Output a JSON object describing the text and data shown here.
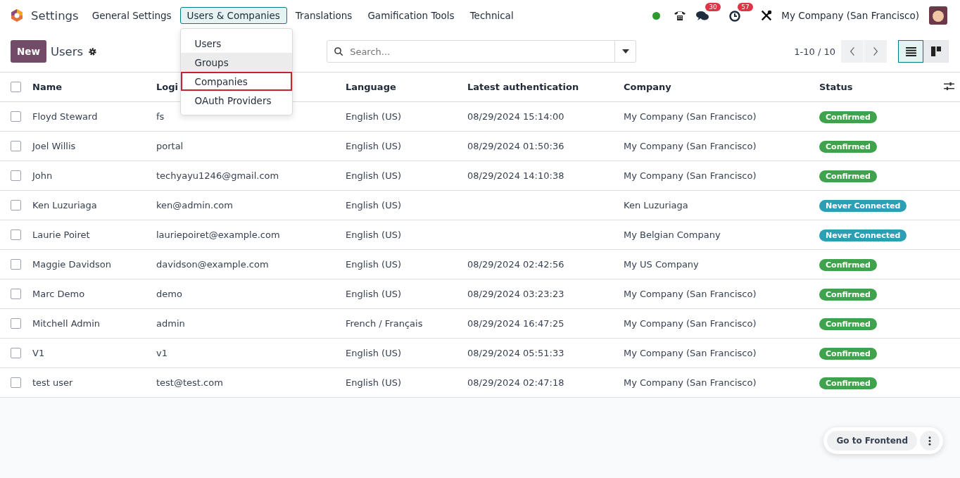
{
  "navbar": {
    "app_name": "Settings",
    "menus": [
      {
        "label": "General Settings",
        "selected": false
      },
      {
        "label": "Users & Companies",
        "selected": true
      },
      {
        "label": "Translations",
        "selected": false
      },
      {
        "label": "Gamification Tools",
        "selected": false
      },
      {
        "label": "Technical",
        "selected": false
      }
    ],
    "messages_badge": "30",
    "activities_badge": "57",
    "company": "My Company (San Francisco)"
  },
  "dropdown": {
    "items": [
      {
        "label": "Users",
        "hovered": false,
        "highlighted": false
      },
      {
        "label": "Groups",
        "hovered": true,
        "highlighted": false
      },
      {
        "label": "Companies",
        "hovered": false,
        "highlighted": true
      },
      {
        "label": "OAuth Providers",
        "hovered": false,
        "highlighted": false
      }
    ]
  },
  "control_panel": {
    "new_button": "New",
    "title": "Users",
    "search": {
      "placeholder": "Search..."
    },
    "pager": "1-10 / 10",
    "views": [
      {
        "kind": "list",
        "selected": true
      },
      {
        "kind": "kanban",
        "selected": false
      }
    ]
  },
  "table": {
    "all_checked": false,
    "columns": [
      "Name",
      "Logi",
      "Language",
      "Latest authentication",
      "Company",
      "Status"
    ],
    "rows": [
      {
        "checked": false,
        "name": "Floyd Steward",
        "login": "fs",
        "language": "English (US)",
        "latest_authentication": "08/29/2024 15:14:00",
        "company": "My Company (San Francisco)",
        "status": "Confirmed",
        "color": "#3fa34d"
      },
      {
        "checked": false,
        "name": "Joel Willis",
        "login": "portal",
        "language": "English (US)",
        "latest_authentication": "08/29/2024 01:50:36",
        "company": "My Company (San Francisco)",
        "status": "Confirmed",
        "color": "#3fa34d"
      },
      {
        "checked": false,
        "name": "John",
        "login": "techyayu1246@gmail.com",
        "language": "English (US)",
        "latest_authentication": "08/29/2024 14:10:38",
        "company": "My Company (San Francisco)",
        "status": "Confirmed",
        "color": "#3fa34d"
      },
      {
        "checked": false,
        "name": "Ken Luzuriaga",
        "login": "ken@admin.com",
        "language": "English (US)",
        "latest_authentication": "",
        "company": "Ken Luzuriaga",
        "status": "Never Connected",
        "color": "#2a9fb5"
      },
      {
        "checked": false,
        "name": "Laurie Poiret",
        "login": "lauriepoiret@example.com",
        "language": "English (US)",
        "latest_authentication": "",
        "company": "My Belgian Company",
        "status": "Never Connected",
        "color": "#2a9fb5"
      },
      {
        "checked": false,
        "name": "Maggie Davidson",
        "login": "davidson@example.com",
        "language": "English (US)",
        "latest_authentication": "08/29/2024 02:42:56",
        "company": "My US Company",
        "status": "Confirmed",
        "color": "#3fa34d"
      },
      {
        "checked": false,
        "name": "Marc Demo",
        "login": "demo",
        "language": "English (US)",
        "latest_authentication": "08/29/2024 03:23:23",
        "company": "My Company (San Francisco)",
        "status": "Confirmed",
        "color": "#3fa34d"
      },
      {
        "checked": false,
        "name": "Mitchell Admin",
        "login": "admin",
        "language": "French / Français",
        "latest_authentication": "08/29/2024 16:47:25",
        "company": "My Company (San Francisco)",
        "status": "Confirmed",
        "color": "#3fa34d"
      },
      {
        "checked": false,
        "name": "V1",
        "login": "v1",
        "language": "English (US)",
        "latest_authentication": "08/29/2024 05:51:33",
        "company": "My Company (San Francisco)",
        "status": "Confirmed",
        "color": "#3fa34d"
      },
      {
        "checked": false,
        "name": "test user",
        "login": "test@test.com",
        "language": "English (US)",
        "latest_authentication": "08/29/2024 02:47:18",
        "company": "My Company (San Francisco)",
        "status": "Confirmed",
        "color": "#3fa34d"
      }
    ]
  },
  "floating": {
    "button": "Go to Frontend"
  }
}
